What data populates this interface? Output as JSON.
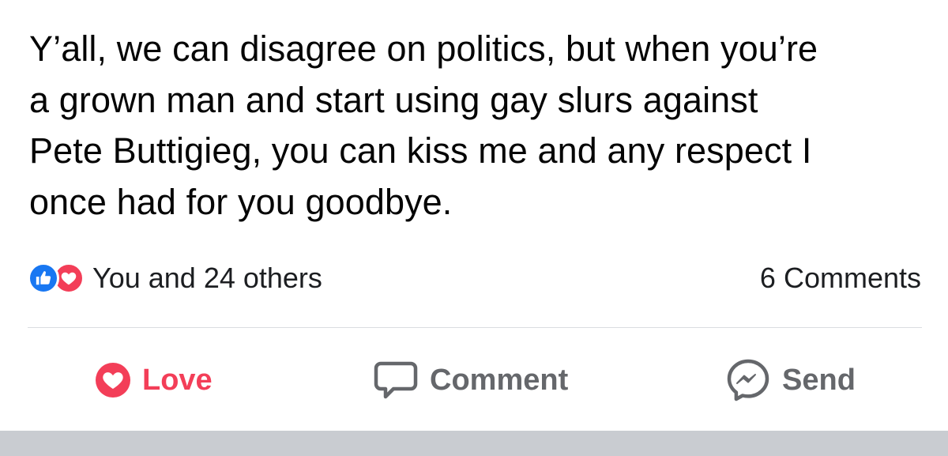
{
  "post": {
    "text_lines": [
      "Y’all, we can disagree on politics, but when you’re",
      "a grown man and start using gay slurs against",
      "Pete Buttigieg, you can kiss me and any respect I",
      "once had for you goodbye."
    ]
  },
  "reactions": {
    "icons": [
      "like-icon",
      "love-icon"
    ],
    "summary": "You and 24 others",
    "comments": "6 Comments"
  },
  "actions": {
    "love_label": "Love",
    "comment_label": "Comment",
    "send_label": "Send"
  },
  "colors": {
    "like_blue": "#1877f2",
    "love_red": "#f33e58",
    "action_gray": "#65676b",
    "divider": "#dadde1",
    "bottom_bar": "#c9ccd1"
  }
}
